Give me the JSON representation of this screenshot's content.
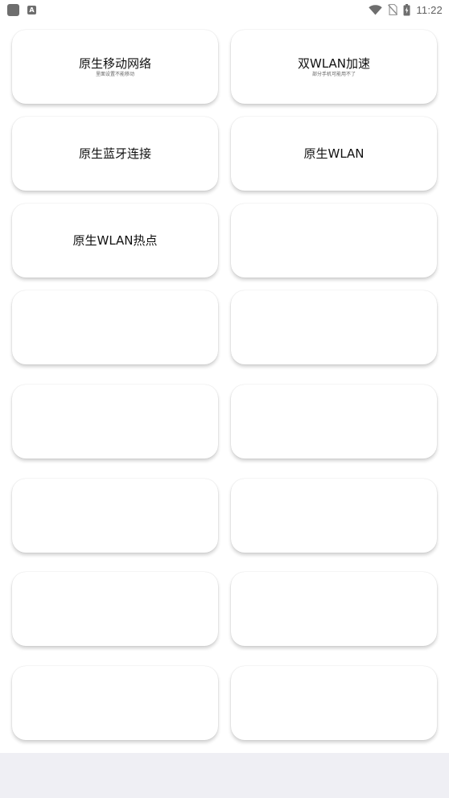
{
  "status_bar": {
    "time": "11:22",
    "a_icon_label": "A"
  },
  "cards": [
    {
      "title": "原生移动网络",
      "subtitle": "里面设置不能移动"
    },
    {
      "title": "双WLAN加速",
      "subtitle": "部分手机可能用不了"
    },
    {
      "title": "原生蓝牙连接",
      "subtitle": ""
    },
    {
      "title": "原生WLAN",
      "subtitle": ""
    },
    {
      "title": "原生WLAN热点",
      "subtitle": ""
    },
    {
      "title": "",
      "subtitle": ""
    },
    {
      "title": "",
      "subtitle": ""
    },
    {
      "title": "",
      "subtitle": ""
    },
    {
      "title": "",
      "subtitle": ""
    },
    {
      "title": "",
      "subtitle": ""
    },
    {
      "title": "",
      "subtitle": ""
    },
    {
      "title": "",
      "subtitle": ""
    },
    {
      "title": "",
      "subtitle": ""
    },
    {
      "title": "",
      "subtitle": ""
    },
    {
      "title": "",
      "subtitle": ""
    },
    {
      "title": "",
      "subtitle": ""
    }
  ],
  "colors": {
    "card_background": "#ffffff",
    "bottom_area": "#efeff4",
    "status_icons": "#6e6e6e"
  }
}
